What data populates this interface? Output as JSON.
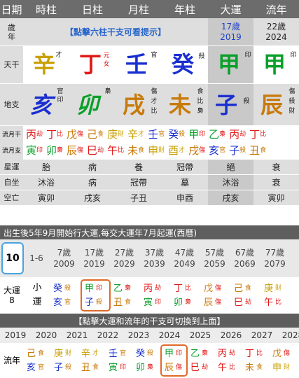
{
  "header": [
    "日期",
    "時柱",
    "日柱",
    "月柱",
    "年柱",
    "大運",
    "流年"
  ],
  "age_row": {
    "label": [
      "歲",
      "年"
    ],
    "notice": "【點擊六柱干支可看提示】",
    "dayun": [
      "17歲",
      "2019"
    ],
    "liunian": [
      "22歲",
      "2024"
    ]
  },
  "stem_row": {
    "label": "天干",
    "chars": [
      "辛",
      "丁",
      "壬",
      "癸",
      "甲",
      "甲"
    ],
    "god": [
      "才",
      "元女",
      "官",
      "殺",
      "印",
      "印"
    ]
  },
  "branch_row": {
    "label": "地支",
    "chars": [
      "亥",
      "卯",
      "戌",
      "未",
      "子",
      "辰"
    ],
    "hidden": [
      [
        "官",
        "印"
      ],
      [
        "梟"
      ],
      [
        "傷",
        "才",
        "比"
      ],
      [
        "食",
        "比",
        "梟"
      ],
      [
        "殺"
      ],
      [
        "傷",
        "殺",
        "財"
      ]
    ]
  },
  "liuyue": {
    "label": [
      "流月干",
      "流月支"
    ],
    "stems": [
      [
        "丙",
        "劫"
      ],
      [
        "丁",
        "比"
      ],
      [
        "戊",
        "傷"
      ],
      [
        "己",
        "食"
      ],
      [
        "庚",
        "財"
      ],
      [
        "辛",
        "才"
      ],
      [
        "壬",
        "官"
      ],
      [
        "癸",
        "殺"
      ],
      [
        "甲",
        "印"
      ],
      [
        "乙",
        "梟"
      ],
      [
        "丙",
        "劫"
      ],
      [
        "丁",
        "比"
      ]
    ],
    "branches": [
      [
        "寅",
        "印"
      ],
      [
        "卯",
        "梟"
      ],
      [
        "辰",
        "傷"
      ],
      [
        "巳",
        "劫"
      ],
      [
        "午",
        "比"
      ],
      [
        "未",
        "食"
      ],
      [
        "申",
        "財"
      ],
      [
        "酉",
        "才"
      ],
      [
        "戌",
        "傷"
      ],
      [
        "亥",
        "官"
      ],
      [
        "子",
        "殺"
      ],
      [
        "丑",
        "食"
      ]
    ]
  },
  "info_rows": [
    {
      "label": "星運",
      "values": [
        "胎",
        "病",
        "養",
        "冠帶",
        "絕",
        "衰"
      ]
    },
    {
      "label": "自坐",
      "values": [
        "沐浴",
        "病",
        "冠帶",
        "墓",
        "沐浴",
        "衰"
      ]
    },
    {
      "label": "空亡",
      "values": [
        "寅卯",
        "戌亥",
        "子丑",
        "申酉",
        "戌亥",
        "寅卯"
      ]
    }
  ],
  "dayun_section": {
    "bar": "出生後5年9月開始行大運,每交大運年7月起運(西曆)",
    "current": "10",
    "first": "1-6",
    "label": [
      "大運",
      "8"
    ],
    "small": [
      "小",
      "運"
    ],
    "cols": [
      {
        "age": "7歲",
        "year": "2009",
        "s": [
          "癸",
          "殺"
        ],
        "b": [
          "亥",
          "官"
        ]
      },
      {
        "age": "17歲",
        "year": "2019",
        "s": [
          "甲",
          "印"
        ],
        "b": [
          "子",
          "殺"
        ]
      },
      {
        "age": "27歲",
        "year": "2029",
        "s": [
          "乙",
          "梟"
        ],
        "b": [
          "丑",
          "食"
        ]
      },
      {
        "age": "37歲",
        "year": "2039",
        "s": [
          "丙",
          "劫"
        ],
        "b": [
          "寅",
          "印"
        ]
      },
      {
        "age": "47歲",
        "year": "2049",
        "s": [
          "丁",
          "比"
        ],
        "b": [
          "卯",
          "梟"
        ]
      },
      {
        "age": "57歲",
        "year": "2059",
        "s": [
          "戊",
          "傷"
        ],
        "b": [
          "辰",
          "傷"
        ]
      },
      {
        "age": "67歲",
        "year": "2069",
        "s": [
          "己",
          "食"
        ],
        "b": [
          "巳",
          "劫"
        ]
      },
      {
        "age": "77歲",
        "year": "2079",
        "s": [
          "庚",
          "財"
        ],
        "b": [
          "午",
          "比"
        ]
      }
    ]
  },
  "liunian_section": {
    "bar": "【點擊大運和流年的干支可切換到上面】",
    "label": "流年",
    "years": [
      {
        "y": "2019",
        "s": [
          "己",
          "食"
        ],
        "b": [
          "亥",
          "官"
        ]
      },
      {
        "y": "2020",
        "s": [
          "庚",
          "財"
        ],
        "b": [
          "子",
          "殺"
        ]
      },
      {
        "y": "2021",
        "s": [
          "辛",
          "才"
        ],
        "b": [
          "丑",
          "食"
        ]
      },
      {
        "y": "2022",
        "s": [
          "壬",
          "官"
        ],
        "b": [
          "寅",
          "印"
        ]
      },
      {
        "y": "2023",
        "s": [
          "癸",
          "殺"
        ],
        "b": [
          "卯",
          "梟"
        ]
      },
      {
        "y": "2024",
        "s": [
          "甲",
          "印"
        ],
        "b": [
          "辰",
          "傷"
        ]
      },
      {
        "y": "2025",
        "s": [
          "乙",
          "梟"
        ],
        "b": [
          "巳",
          "劫"
        ]
      },
      {
        "y": "2026",
        "s": [
          "丙",
          "劫"
        ],
        "b": [
          "午",
          "比"
        ]
      },
      {
        "y": "2027",
        "s": [
          "丁",
          "比"
        ],
        "b": [
          "未",
          "食"
        ]
      },
      {
        "y": "2028",
        "s": [
          "戊",
          "傷"
        ],
        "b": [
          "申",
          "財"
        ]
      }
    ]
  },
  "colors": {
    "water": "#1a2fd0",
    "wood": "#0aa02a",
    "fire": "#e01818",
    "earth": "#c87a0a",
    "metal": "#c8a000",
    "accent": "#2a66cc",
    "highlight": "#e06a2a"
  }
}
